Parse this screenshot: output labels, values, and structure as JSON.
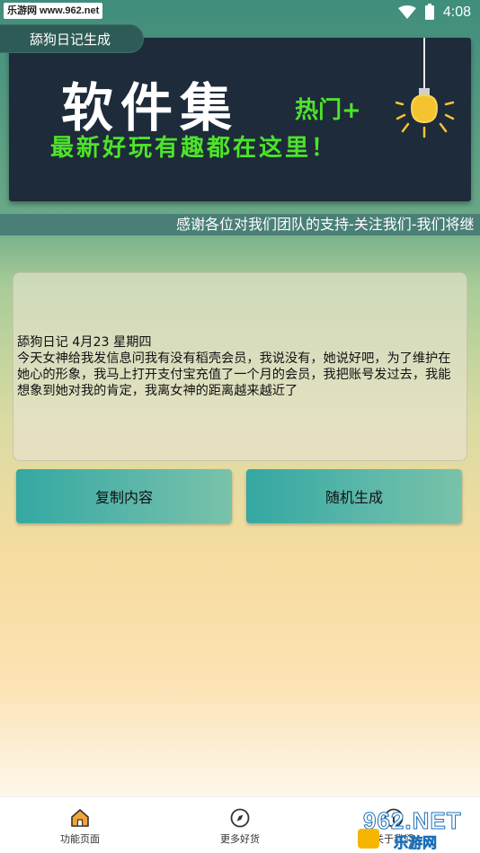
{
  "status_bar": {
    "watermark": "乐游网 www.962.net",
    "time": "4:08"
  },
  "app": {
    "title": "舔狗日记生成"
  },
  "banner": {
    "title": "软件集",
    "hot": "热门+",
    "subtitle": "最新好玩有趣都在这里！"
  },
  "marquee": {
    "text": "感谢各位对我们团队的支持-关注我们-我们将继"
  },
  "diary": {
    "text": "舔狗日记 4月23 星期四\n今天女神给我发信息问我有没有稻壳会员，我说没有，她说好吧，为了维护在她心的形象，我马上打开支付宝充值了一个月的会员，我把账号发过去，我能想象到她对我的肯定，我离女神的距离越来越近了"
  },
  "buttons": {
    "copy": "复制内容",
    "random": "随机生成"
  },
  "bottom_nav": {
    "items": [
      {
        "label": "功能页面",
        "icon": "home-icon"
      },
      {
        "label": "更多好货",
        "icon": "compass-icon"
      },
      {
        "label": "关于我们",
        "icon": "info-icon"
      }
    ]
  },
  "watermark_bottom": {
    "logo": "962.NET",
    "sub": "乐游网"
  },
  "colors": {
    "banner_bg": "#1d2b3a",
    "banner_green": "#4ee32a",
    "button_teal": "#34a8a2",
    "marquee_bg": "#4a7f77"
  }
}
